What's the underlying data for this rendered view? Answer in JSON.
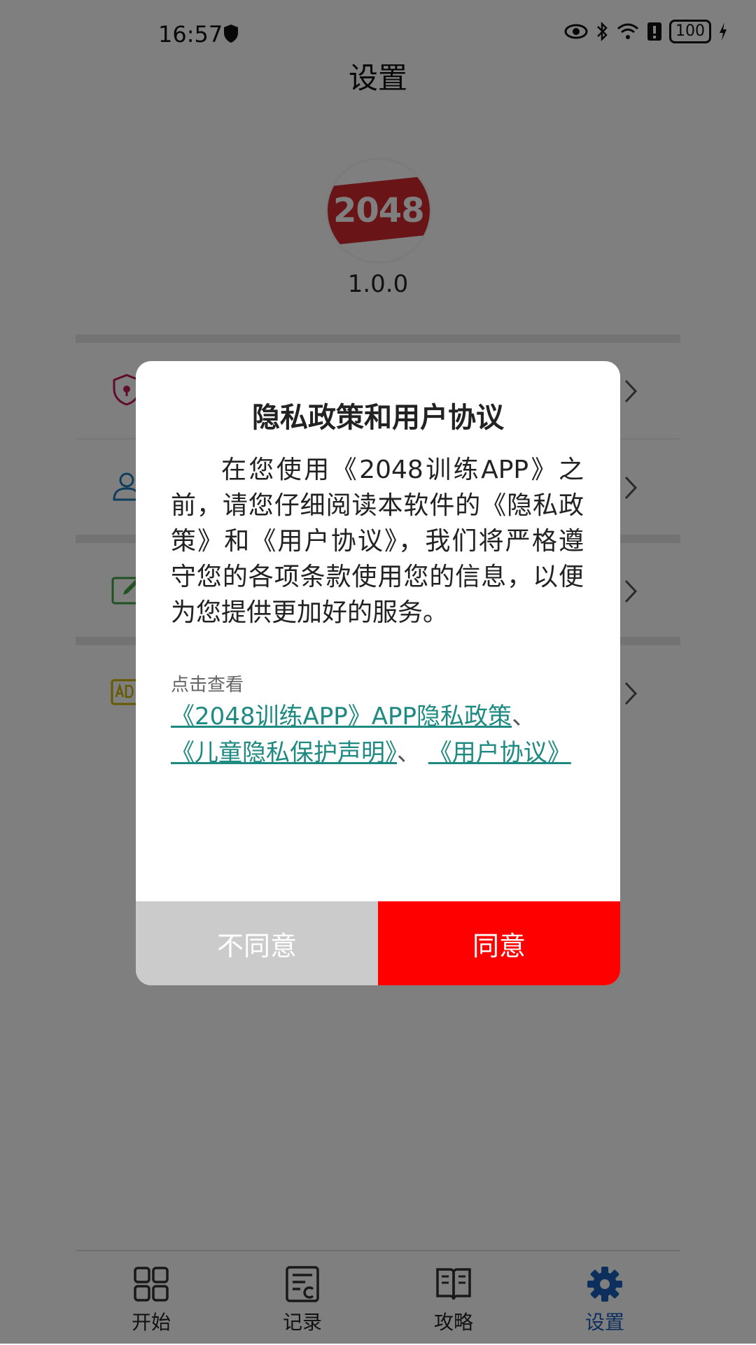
{
  "status_bar": {
    "time": "16:57",
    "battery": "100"
  },
  "header": {
    "title": "设置"
  },
  "app_info": {
    "logo_text": "2048",
    "version": "1.0.0"
  },
  "settings_items": [
    {
      "icon": "shield-lock-icon",
      "color": "#c2185b"
    },
    {
      "icon": "user-icon",
      "color": "#1e7ab8"
    },
    {
      "icon": "edit-icon",
      "color": "#43a047"
    },
    {
      "icon": "ad-icon",
      "color": "#c8b400"
    }
  ],
  "dialog": {
    "title": "隐私政策和用户协议",
    "body": "在您使用《2048训练APP》之前，请您仔细阅读本软件的《隐私政策》和《用户协议》，我们将严格遵守您的各项条款使用您的信息，以便为您提供更加好的服务。",
    "view_label": "点击查看",
    "links": {
      "privacy_policy": "《2048训练APP》APP隐私政策",
      "child_privacy": "《儿童隐私保护声明》",
      "user_agreement": "《用户协议》",
      "separator": "、"
    },
    "buttons": {
      "disagree": "不同意",
      "agree": "同意"
    }
  },
  "bottom_nav": [
    {
      "label": "开始",
      "icon": "grid-icon"
    },
    {
      "label": "记录",
      "icon": "record-icon"
    },
    {
      "label": "攻略",
      "icon": "book-icon"
    },
    {
      "label": "设置",
      "icon": "gear-icon",
      "active": true
    }
  ],
  "colors": {
    "accent": "#fe0000",
    "link": "#1e8a82",
    "nav_active": "#1a5ebd",
    "disagree": "#cbcbcb"
  }
}
